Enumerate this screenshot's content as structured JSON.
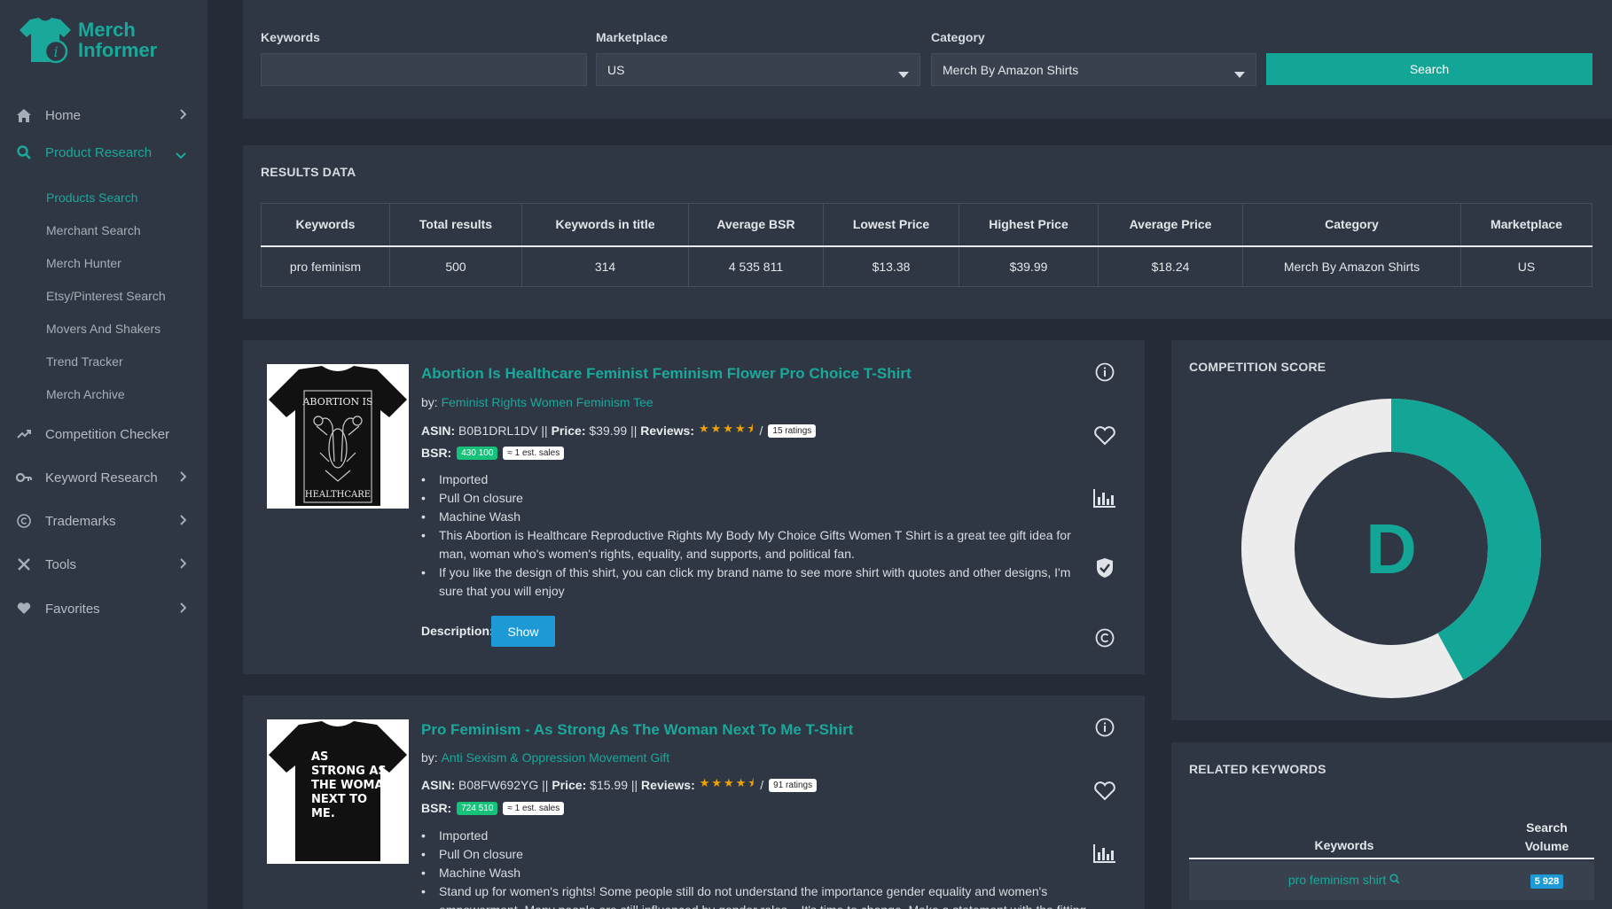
{
  "app": {
    "logo_line1": "Merch",
    "logo_line2": "Informer"
  },
  "sidebar": {
    "home": "Home",
    "product_research": "Product Research",
    "sub_items": [
      "Products Search",
      "Merchant Search",
      "Merch Hunter",
      "Etsy/Pinterest Search",
      "Movers And Shakers",
      "Trend Tracker",
      "Merch Archive"
    ],
    "competition_checker": "Competition Checker",
    "keyword_research": "Keyword Research",
    "trademarks": "Trademarks",
    "tools": "Tools",
    "favorites": "Favorites"
  },
  "search": {
    "keywords_label": "Keywords",
    "keywords_value": "",
    "marketplace_label": "Marketplace",
    "marketplace_value": "US",
    "category_label": "Category",
    "category_value": "Merch By Amazon Shirts",
    "search_button": "Search"
  },
  "results": {
    "title": "RESULTS DATA",
    "headers": [
      "Keywords",
      "Total results",
      "Keywords in title",
      "Average BSR",
      "Lowest Price",
      "Highest Price",
      "Average Price",
      "Category",
      "Marketplace"
    ],
    "row": [
      "pro feminism",
      "500",
      "314",
      "4 535 811",
      "$13.38",
      "$39.99",
      "$18.24",
      "Merch By Amazon Shirts",
      "US"
    ]
  },
  "products": [
    {
      "title": "Abortion Is Healthcare Feminist Feminism Flower Pro Choice T-Shirt",
      "by_label": "by:",
      "brand": "Feminist Rights Women Feminism Tee",
      "asin_label": "ASIN:",
      "asin": "B0B1DRL1DV",
      "price_label": "Price:",
      "price": "$39.99",
      "reviews_label": "Reviews:",
      "stars": "★★★★⯨",
      "ratings": "15 ratings",
      "bsr_label": "BSR:",
      "bsr": "430 100",
      "est_sales": "≈ 1 est. sales",
      "bullets": [
        "Imported",
        "Pull On closure",
        "Machine Wash",
        "This Abortion is Healthcare Reproductive Rights My Body My Choice Gifts Women T Shirt is a great tee gift idea for man, woman who's women's rights, equality, and supports, and political fan.",
        "If you like the design of this shirt, you can click my brand name to see more shirt with quotes and other designs, I'm sure that you will enjoy"
      ],
      "description_label": "Description:",
      "show_button": "Show",
      "shirt_text_top": "ABORTION IS",
      "shirt_text_bottom": "HEALTHCARE"
    },
    {
      "title": "Pro Feminism - As Strong As The Woman Next To Me T-Shirt",
      "by_label": "by:",
      "brand": "Anti Sexism & Oppression Movement Gift",
      "asin_label": "ASIN:",
      "asin": "B08FW692YG",
      "price_label": "Price:",
      "price": "$15.99",
      "reviews_label": "Reviews:",
      "stars": "★★★★⯨",
      "ratings": "91 ratings",
      "bsr_label": "BSR:",
      "bsr": "724 510",
      "est_sales": "≈ 1 est. sales",
      "bullets": [
        "Imported",
        "Pull On closure",
        "Machine Wash",
        "Stand up for women's rights! Some people still do not understand the importance gender equality and women's empowerment. Many people are still influenced by gender roles... It's time to change. Make a statement with the fitting"
      ],
      "shirt_lines": [
        "AS",
        "STRONG AS",
        "THE WOMAN",
        "NEXT TO",
        "ME."
      ]
    }
  ],
  "competition": {
    "title": "COMPETITION SCORE",
    "grade": "D",
    "score_fraction": 0.42,
    "color_fill": "#13a697",
    "color_rest": "#ececec"
  },
  "related": {
    "title": "RELATED KEYWORDS",
    "col_keywords": "Keywords",
    "col_volume_1": "Search",
    "col_volume_2": "Volume",
    "rows": [
      {
        "keyword": "pro feminism shirt",
        "volume": "5 928"
      }
    ]
  }
}
